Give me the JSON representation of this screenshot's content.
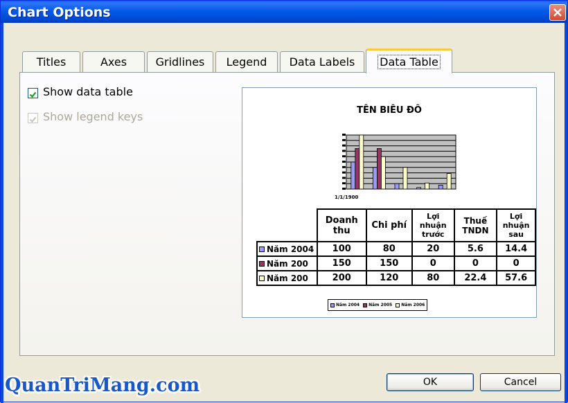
{
  "dialog": {
    "title": "Chart Options"
  },
  "tabs": [
    {
      "label": "Titles"
    },
    {
      "label": "Axes"
    },
    {
      "label": "Gridlines"
    },
    {
      "label": "Legend"
    },
    {
      "label": "Data Labels"
    },
    {
      "label": "Data Table",
      "active": true
    }
  ],
  "options": {
    "show_data_table": {
      "label": "Show data table",
      "checked": true,
      "enabled": true
    },
    "show_legend_keys": {
      "label": "Show legend keys",
      "checked": true,
      "enabled": false
    }
  },
  "preview": {
    "chart_title": "TÊN BIÊU ĐÔ",
    "axis_category_label": "1/1/1900",
    "colors": {
      "series1": "#9999FF",
      "series2": "#993366",
      "series3": "#FFFFCC",
      "plot_bg": "#C0C0C0"
    },
    "table": {
      "headers": [
        "Doanh thu",
        "Chi phí",
        "Lợi nhuận trước",
        "Thuế TNDN",
        "Lợi nhuận sau"
      ],
      "rows": [
        {
          "series": "Năm 2004",
          "values": [
            "100",
            "80",
            "20",
            "5.6",
            "14.4"
          ]
        },
        {
          "series": "Năm 200",
          "values": [
            "150",
            "150",
            "0",
            "0",
            "0"
          ]
        },
        {
          "series": "Năm 200",
          "values": [
            "200",
            "120",
            "80",
            "22.4",
            "57.6"
          ]
        }
      ]
    },
    "legend": [
      "Năm 2004",
      "Năm 2005",
      "Năm 2006"
    ]
  },
  "chart_data": {
    "type": "bar",
    "title": "TÊN BIÊU ĐÔ",
    "categories": [
      "Doanh thu",
      "Chi phí",
      "Lợi nhuận trước",
      "Thuế TNDN",
      "Lợi nhuận sau"
    ],
    "series": [
      {
        "name": "Năm 2004",
        "values": [
          100,
          80,
          20,
          5.6,
          14.4
        ]
      },
      {
        "name": "Năm 2005",
        "values": [
          150,
          150,
          0,
          0,
          0
        ]
      },
      {
        "name": "Năm 2006",
        "values": [
          200,
          120,
          80,
          22.4,
          57.6
        ]
      }
    ],
    "ylim": [
      0,
      200
    ],
    "grid": true
  },
  "buttons": {
    "ok": "OK",
    "cancel": "Cancel"
  },
  "watermark": "QuanTriMang.com"
}
